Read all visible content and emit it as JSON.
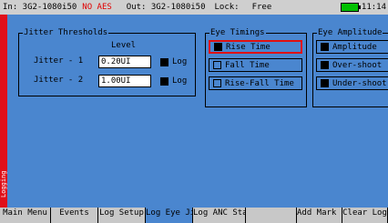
{
  "status": {
    "input": "In: 3G2-1080i50",
    "no_aes": "NO AES",
    "output": "Out: 3G2-1080i50",
    "lock": "Lock:",
    "lock_value": "Free",
    "time": "11:14"
  },
  "side_tab": {
    "label": "Logging"
  },
  "jitter_thresholds": {
    "title": "Jitter Thresholds",
    "level_header": "Level",
    "rows": [
      {
        "label": "Jitter - 1",
        "value": "0.20UI",
        "log_label": "Log",
        "log_checked": true
      },
      {
        "label": "Jitter - 2",
        "value": "1.00UI",
        "log_label": "Log",
        "log_checked": true
      }
    ]
  },
  "eye_timings": {
    "title": "Eye Timings",
    "items": [
      {
        "label": "Rise Time",
        "checked": true,
        "highlighted": true
      },
      {
        "label": "Fall Time",
        "checked": false,
        "highlighted": false
      },
      {
        "label": "Rise-Fall Time",
        "checked": false,
        "highlighted": false
      }
    ]
  },
  "eye_amplitude": {
    "title": "Eye Amplitude",
    "items": [
      {
        "label": "Amplitude",
        "checked": true
      },
      {
        "label": "Over-shoot",
        "checked": true
      },
      {
        "label": "Under-shoot",
        "checked": true
      }
    ]
  },
  "softkeys": [
    {
      "label": "Main Menu",
      "active": false
    },
    {
      "label": "Events",
      "active": false
    },
    {
      "label": "Log Setup",
      "active": false
    },
    {
      "label": "Log Eye Jitter",
      "active": true
    },
    {
      "label": "Log ANC Status",
      "active": false
    },
    {
      "label": "",
      "active": false
    },
    {
      "label": "Add Mark in Log",
      "active": false
    },
    {
      "label": "Clear Log",
      "active": false
    }
  ],
  "colors": {
    "panel_blue": "#4a86cf",
    "side_tab_red": "#e0101a",
    "status_gray": "#cfcfcf",
    "alert_red": "#e00000",
    "battery_green": "#00c000"
  }
}
